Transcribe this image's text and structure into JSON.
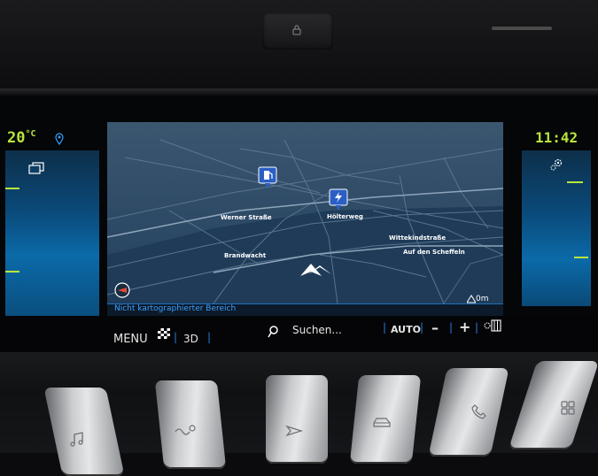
{
  "status": {
    "temperature": "20",
    "temperature_unit": "°C",
    "clock": "11:42"
  },
  "map": {
    "streets": [
      {
        "label": "Werner Straße"
      },
      {
        "label": "Hölterweg"
      },
      {
        "label": "Wittekindstraße"
      },
      {
        "label": "Auf den Scheffeln"
      },
      {
        "label": "Brandwacht"
      }
    ],
    "status_text": "Nicht kartographierter Bereich",
    "scale_text": "0m",
    "pois": [
      {
        "icon": "fuel-station-icon"
      },
      {
        "icon": "charging-station-icon"
      }
    ]
  },
  "toolbar": {
    "menu_label": "MENU",
    "view_label": "3D",
    "search_label": "Suchen...",
    "auto_label": "AUTO",
    "zoom_out_label": "–",
    "zoom_in_label": "+"
  },
  "colors": {
    "accent_green": "#b9e63c",
    "accent_blue": "#1f7fe0",
    "map_background": "#2f4b66"
  }
}
